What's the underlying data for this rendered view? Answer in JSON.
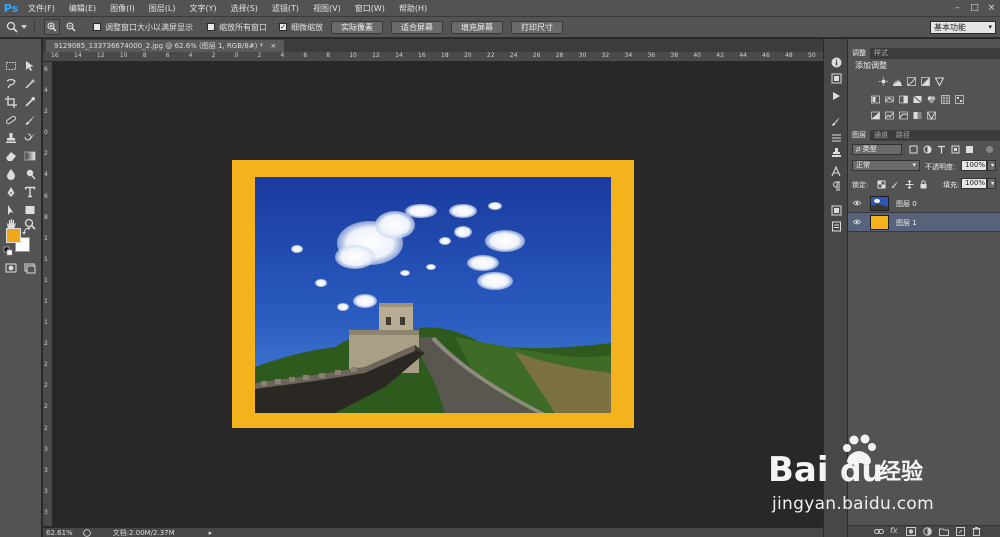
{
  "app": {
    "logo_text": "Ps"
  },
  "menu": [
    "文件(F)",
    "编辑(E)",
    "图像(I)",
    "图层(L)",
    "文字(Y)",
    "选择(S)",
    "滤镜(T)",
    "视图(V)",
    "窗口(W)",
    "帮助(H)"
  ],
  "window_controls": [
    "–",
    "□",
    "×"
  ],
  "options": {
    "checkboxes": [
      {
        "label": "调整窗口大小以满屏显示",
        "checked": false
      },
      {
        "label": "缩放所有窗口",
        "checked": false
      },
      {
        "label": "细微缩放",
        "checked": true
      }
    ],
    "buttons": [
      "实际像素",
      "适合屏幕",
      "填充屏幕",
      "打印尺寸"
    ],
    "workspace": "基本功能"
  },
  "document": {
    "tab_title": "9129085_133736674000_2.jpg @ 62.6% (图层 1, RGB/8#) *",
    "close_glyph": "×"
  },
  "ruler": {
    "h_labels": [
      "16",
      "14",
      "12",
      "10",
      "8",
      "6",
      "4",
      "2",
      "0",
      "2",
      "4",
      "6",
      "8",
      "10",
      "12",
      "14",
      "16",
      "18",
      "20",
      "22",
      "24",
      "26",
      "28",
      "30",
      "32",
      "34",
      "36",
      "38",
      "40",
      "42",
      "44",
      "46",
      "48",
      "50"
    ],
    "v_labels": [
      "6",
      "4",
      "2",
      "0",
      "2",
      "4",
      "6",
      "8",
      "1",
      "1",
      "1",
      "1",
      "1",
      "2",
      "2",
      "2",
      "2",
      "2",
      "3",
      "3",
      "3",
      "3"
    ]
  },
  "status": {
    "zoom": "62.61%",
    "doc_info": "文档:2.00M/2.37M",
    "arrow": "▸"
  },
  "colors": {
    "foreground": "#f0a818",
    "background": "#ffffff",
    "frame": "#f4b21d",
    "sky_top": "#1b3ea6",
    "sky_bottom": "#3f78cf"
  },
  "panels": {
    "adjust_tabs": [
      "调整",
      "样式"
    ],
    "adjust_title": "添加调整",
    "layer_tabs": [
      "图层",
      "通道",
      "路径"
    ],
    "filter_kind": "ρ 类型",
    "blend_mode": "正常",
    "opacity_label": "不透明度:",
    "opacity_value": "100%",
    "lock_label": "锁定:",
    "fill_label": "填充:",
    "fill_value": "100%",
    "layers": [
      {
        "name": "图层 0",
        "selected": false
      },
      {
        "name": "图层 1",
        "selected": true
      }
    ]
  },
  "watermark": {
    "brand": "Bai",
    "brand_suffix": "经验",
    "url": "jingyan.baidu.com"
  }
}
